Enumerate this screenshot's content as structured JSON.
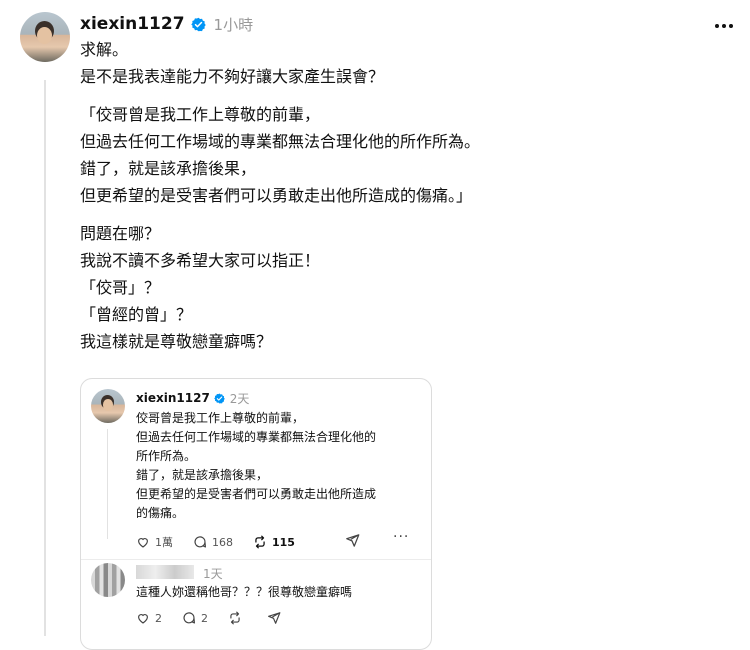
{
  "post": {
    "username": "xiexin1127",
    "time": "1小時",
    "lines": [
      "求解。",
      "是不是我表達能力不夠好讓大家產生誤會？",
      "",
      "「佼哥曾是我工作上尊敬的前輩，",
      "但過去任何工作場域的專業都無法合理化他的所作所為。",
      "錯了，就是該承擔後果，",
      "但更希望的是受害者們可以勇敢走出他所造成的傷痛。」",
      "",
      "問題在哪？",
      "我說不讀不多希望大家可以指正！",
      "「佼哥」？",
      "「曾經的曾」？",
      "我這樣就是尊敬戀童癖嗎？"
    ]
  },
  "quoted_post": {
    "username": "xiexin1127",
    "time": "2天",
    "lines": [
      "佼哥曾是我工作上尊敬的前輩，",
      "但過去任何工作場域的專業都無法合理化他的",
      "所作所為。",
      "錯了，就是該承擔後果，",
      "但更希望的是受害者們可以勇敢走出他所造成",
      "的傷痛。"
    ],
    "likes": "1萬",
    "comments": "168",
    "reposts": "115"
  },
  "reply": {
    "time": "1天",
    "text": "這種人妳還稱他哥？？？很尊敬戀童癖嗎",
    "likes": "2",
    "comments": "2"
  },
  "colors": {
    "verified": "#0095f6",
    "muted": "#999999",
    "text": "#111111",
    "border": "#dcdcdc"
  },
  "icons": [
    "verified-badge-icon",
    "more-icon",
    "heart-icon",
    "comment-icon",
    "repost-icon",
    "share-icon"
  ]
}
